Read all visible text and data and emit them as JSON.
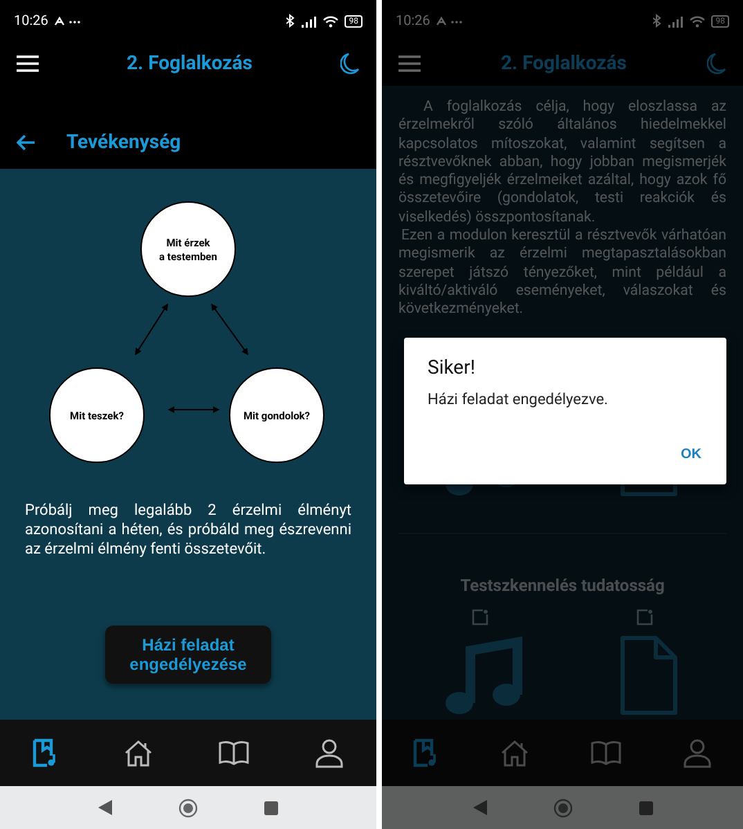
{
  "screens": [
    {
      "kind": "activity",
      "dimmed": false,
      "status_bar": {
        "time": "10:26",
        "battery": "98"
      },
      "app_bar": {
        "title": "2. Foglalkozás"
      },
      "sub_header": {
        "title": "Tevékenység"
      },
      "diagram": {
        "nodes": [
          {
            "lines": [
              "Mit érzek",
              "a testemben"
            ]
          },
          {
            "lines": [
              "Mit teszek?"
            ]
          },
          {
            "lines": [
              "Mit gondolok?"
            ]
          }
        ]
      },
      "instruction": "Próbálj meg legalább 2 érzelmi élményt azonosítani a héten, és próbáld meg észrevenni az érzelmi élmény fenti összetevőit.",
      "button": "Házi feladat engedélyezése",
      "bottom_nav": [
        {
          "selected": true
        },
        {
          "selected": false
        },
        {
          "selected": false
        },
        {
          "selected": false
        }
      ]
    },
    {
      "kind": "module",
      "dimmed": true,
      "status_bar": {
        "time": "10:26",
        "battery": "98"
      },
      "app_bar": {
        "title": "2. Foglalkozás"
      },
      "paragraphs": [
        "A foglalkozás célja, hogy eloszlassa az érzelmekről szóló általános hiedelmekkel kapcsolatos mítoszokat, valamint segítsen a résztvevőknek abban, hogy jobban megismerjék és megfigyeljék érzelmeiket azáltal, hogy azok fő összetevőire (gondolatok, testi reakciók és viselkedés) összpontosítanak.",
        "Ezen a modulon keresztül a résztvevők várhatóan megismerik az érzelmi megtapasztalásokban szerepet játszó tényezőket, mint például a kiváltó/aktiváló eseményeket, válaszokat és következményeket."
      ],
      "sections": [
        {
          "has_open_links": false
        },
        {
          "title": "Testszkennelés tudatosság",
          "has_open_links": true
        }
      ],
      "dialog": {
        "title": "Siker!",
        "message": "Házi feladat engedélyezve.",
        "button": "OK"
      },
      "bottom_nav": [
        {
          "selected": true
        },
        {
          "selected": false
        },
        {
          "selected": false
        },
        {
          "selected": false
        }
      ]
    }
  ]
}
